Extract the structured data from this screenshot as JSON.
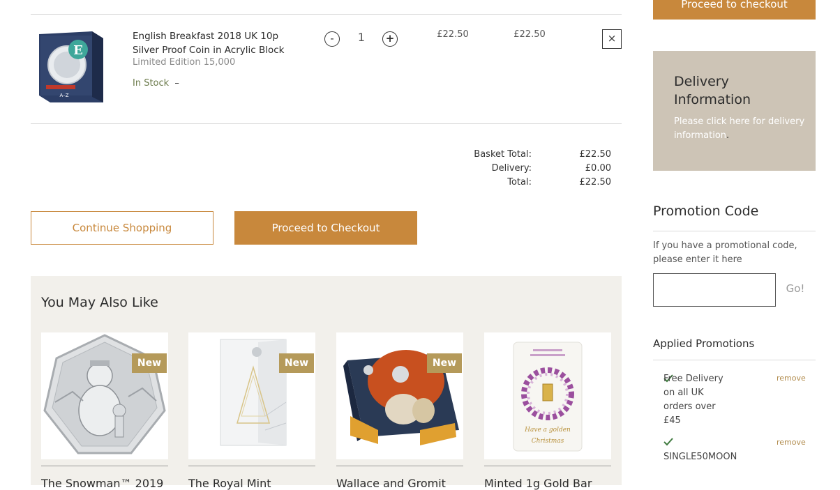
{
  "basket_item": {
    "title": "English Breakfast 2018 UK 10p Silver Proof Coin in Acrylic Block",
    "edition": "Limited Edition 15,000",
    "stock": "In Stock",
    "stock_suffix": "–",
    "minus": "-",
    "quantity": "1",
    "plus": "+",
    "unit_price": "£22.50",
    "line_total": "£22.50",
    "remove_symbol": "×",
    "thumb_box_letter": "E",
    "thumb_box_footer": "A–Z"
  },
  "totals": {
    "basket_total_label": "Basket Total:",
    "basket_total_value": "£22.50",
    "delivery_label": "Delivery:",
    "delivery_value": "£0.00",
    "total_label": "Total:",
    "total_value": "£22.50"
  },
  "actions": {
    "continue_shopping": "Continue Shopping",
    "proceed_checkout": "Proceed to Checkout"
  },
  "recommendations": {
    "title": "You May Also Like",
    "items": [
      {
        "name": "The Snowman™ 2019",
        "badge": "New"
      },
      {
        "name": "The Royal Mint",
        "badge": "New"
      },
      {
        "name": "Wallace and Gromit",
        "badge": "New"
      },
      {
        "name": "Minted 1g Gold Bar",
        "badge": "",
        "card_lines": [
          "Have a golden",
          "Christmas"
        ]
      }
    ]
  },
  "sidebar": {
    "top_checkout": "Proceed to checkout",
    "delivery": {
      "title": "Delivery Information",
      "text_before": "Please click here for",
      "link": "delivery information",
      "text_after": "."
    },
    "promotion": {
      "title": "Promotion Code",
      "help": "If you have a promotional code, please enter it here",
      "input_value": "",
      "go": "Go!"
    },
    "applied": {
      "title": "Applied Promotions",
      "items": [
        {
          "text": "Free Delivery on all UK orders over £45",
          "remove": "remove"
        },
        {
          "text": "SINGLE50MOON",
          "remove": "remove"
        }
      ]
    }
  },
  "colors": {
    "accent": "#c8883c",
    "badge": "#b59a5a",
    "delivery_box": "#cdc4b6",
    "recommend_bg": "#f2f0eb"
  }
}
